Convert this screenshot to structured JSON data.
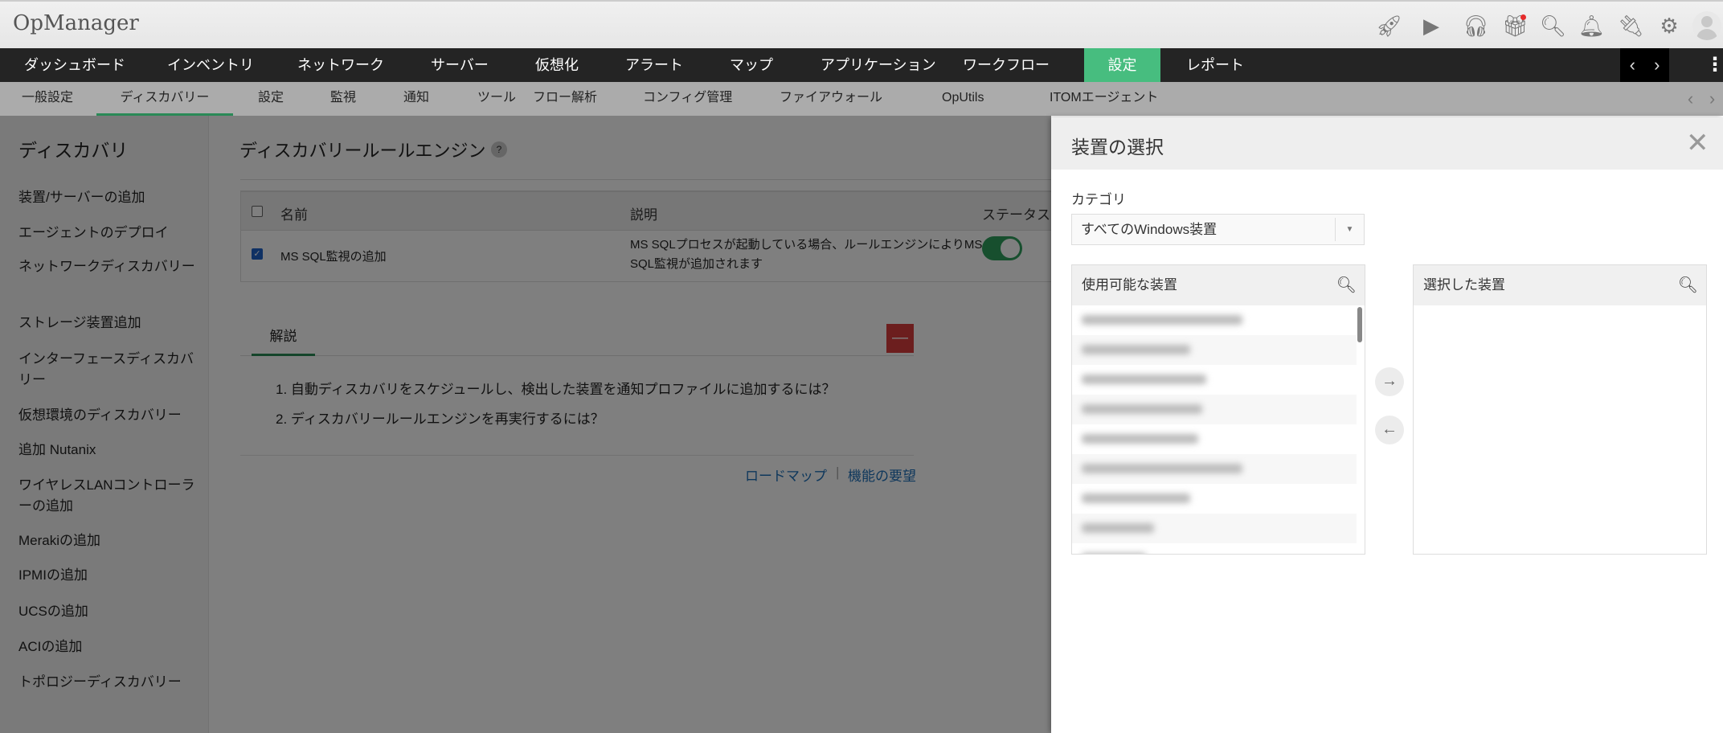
{
  "app": {
    "title": "OpManager"
  },
  "topbar_icons": [
    "rocket-icon",
    "presentation-icon",
    "headset-icon",
    "gift-icon",
    "search-icon",
    "bell-icon",
    "plug-icon",
    "gear-icon",
    "avatar-icon"
  ],
  "nav": {
    "items": [
      "ダッシュボード",
      "インベントリ",
      "ネットワーク",
      "サーバー",
      "仮想化",
      "アラート",
      "マップ",
      "アプリケーション",
      "ワークフロー",
      "設定",
      "レポート"
    ],
    "active": "設定"
  },
  "subnav": {
    "items": [
      "一般設定",
      "ディスカバリー",
      "設定",
      "監視",
      "通知",
      "ツール",
      "フロー解析",
      "コンフィグ管理",
      "ファイアウォール",
      "OpUtils",
      "ITOMエージェント"
    ],
    "active": "ディスカバリー"
  },
  "sidebar": {
    "title": "ディスカバリ",
    "items": [
      "装置/サーバーの追加",
      "エージェントのデプロイ",
      "ネットワークディスカバリー",
      "ストレージ装置追加",
      "インターフェースディスカバリー",
      "仮想環境のディスカバリー",
      "追加 Nutanix",
      "ワイヤレスLANコントローラーの追加",
      "Merakiの追加",
      "IPMIの追加",
      "UCSの追加",
      "ACIの追加",
      "トポロジーディスカバリー"
    ]
  },
  "main": {
    "title": "ディスカバリールールエンジン",
    "help": "?",
    "table": {
      "headers": [
        "名前",
        "説明",
        "ステータス"
      ],
      "rows": [
        {
          "checked": true,
          "name": "MS SQL監視の追加",
          "description": "MS SQLプロセスが起動している場合、ルールエンジンによりMS SQL監視が追加されます",
          "enabled": true
        }
      ]
    },
    "tab": "解説",
    "collapse": "—",
    "faq": [
      "1. 自動ディスカバリをスケジュールし、検出した装置を通知プロファイルに追加するには？",
      "2. ディスカバリールールエンジンを再実行するには？"
    ],
    "links": [
      "ロードマップ",
      "機能の要望"
    ],
    "link_sep": "|"
  },
  "panel": {
    "title": "装置の選択",
    "close": "✕",
    "category_label": "カテゴリ",
    "category_value": "すべてのWindows装置",
    "available_title": "使用可能な装置",
    "selected_title": "選択した装置",
    "available_rows": 9,
    "move_right": "→",
    "move_left": "←"
  }
}
